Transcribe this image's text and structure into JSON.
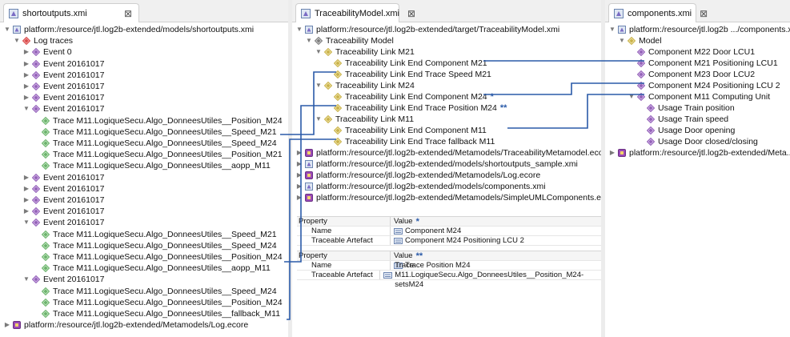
{
  "colors": {
    "link_line": "#2a5aa8",
    "gap": "#ececec",
    "tab_bar": "#f0f0f0"
  },
  "left": {
    "tab_label": "shortoutputs.xmi",
    "close_glyph": "⊠",
    "tree": [
      {
        "label": "platform:/resource/jtl.log2b-extended/models/shortoutputs.xmi",
        "arrow": "▼",
        "icon": "resource-icon",
        "level": 0
      },
      {
        "label": "Log traces",
        "arrow": "▼",
        "icon": "red-diamond-icon",
        "level": 1
      },
      {
        "label": "Event 0",
        "arrow": "▶",
        "icon": "purple-diamond-icon",
        "level": 2
      },
      {
        "label": "Event 20161017",
        "arrow": "▶",
        "icon": "purple-diamond-icon",
        "level": 2
      },
      {
        "label": "Event 20161017",
        "arrow": "▶",
        "icon": "purple-diamond-icon",
        "level": 2
      },
      {
        "label": "Event 20161017",
        "arrow": "▶",
        "icon": "purple-diamond-icon",
        "level": 2
      },
      {
        "label": "Event 20161017",
        "arrow": "▶",
        "icon": "purple-diamond-icon",
        "level": 2
      },
      {
        "label": "Event 20161017",
        "arrow": "▼",
        "icon": "purple-diamond-icon",
        "level": 2
      },
      {
        "label": "Trace M11.LogiqueSecu.Algo_DonneesUtiles__Position_M24",
        "arrow": "",
        "icon": "green-diamond-icon",
        "level": 3
      },
      {
        "label": "Trace M11.LogiqueSecu.Algo_DonneesUtiles__Speed_M21",
        "arrow": "",
        "icon": "green-diamond-icon",
        "level": 3
      },
      {
        "label": "Trace M11.LogiqueSecu.Algo_DonneesUtiles__Speed_M24",
        "arrow": "",
        "icon": "green-diamond-icon",
        "level": 3
      },
      {
        "label": "Trace M11.LogiqueSecu.Algo_DonneesUtiles__Position_M21",
        "arrow": "",
        "icon": "green-diamond-icon",
        "level": 3
      },
      {
        "label": "Trace M11.LogiqueSecu.Algo_DonneesUtiles__aopp_M11",
        "arrow": "",
        "icon": "green-diamond-icon",
        "level": 3
      },
      {
        "label": "Event 20161017",
        "arrow": "▶",
        "icon": "purple-diamond-icon",
        "level": 2
      },
      {
        "label": "Event 20161017",
        "arrow": "▶",
        "icon": "purple-diamond-icon",
        "level": 2
      },
      {
        "label": "Event 20161017",
        "arrow": "▶",
        "icon": "purple-diamond-icon",
        "level": 2
      },
      {
        "label": "Event 20161017",
        "arrow": "▶",
        "icon": "purple-diamond-icon",
        "level": 2
      },
      {
        "label": "Event 20161017",
        "arrow": "▼",
        "icon": "purple-diamond-icon",
        "level": 2
      },
      {
        "label": "Trace M11.LogiqueSecu.Algo_DonneesUtiles__Speed_M21",
        "arrow": "",
        "icon": "green-diamond-icon",
        "level": 3
      },
      {
        "label": "Trace M11.LogiqueSecu.Algo_DonneesUtiles__Speed_M24",
        "arrow": "",
        "icon": "green-diamond-icon",
        "level": 3
      },
      {
        "label": "Trace M11.LogiqueSecu.Algo_DonneesUtiles__Position_M24",
        "arrow": "",
        "icon": "green-diamond-icon",
        "level": 3
      },
      {
        "label": "Trace M11.LogiqueSecu.Algo_DonneesUtiles__aopp_M11",
        "arrow": "",
        "icon": "green-diamond-icon",
        "level": 3
      },
      {
        "label": "Event 20161017",
        "arrow": "▼",
        "icon": "purple-diamond-icon",
        "level": 2
      },
      {
        "label": "Trace M11.LogiqueSecu.Algo_DonneesUtiles__Speed_M24",
        "arrow": "",
        "icon": "green-diamond-icon",
        "level": 3
      },
      {
        "label": "Trace M11.LogiqueSecu.Algo_DonneesUtiles__Position_M24",
        "arrow": "",
        "icon": "green-diamond-icon",
        "level": 3
      },
      {
        "label": "Trace M11.LogiqueSecu.Algo_DonneesUtiles__fallback_M11",
        "arrow": "",
        "icon": "green-diamond-icon",
        "level": 3
      },
      {
        "label": "platform:/resource/jtl.log2b-extended/Metamodels/Log.ecore",
        "arrow": "▶",
        "icon": "ecore-icon",
        "level": 0
      }
    ]
  },
  "middle": {
    "tab_label": "TraceabilityModel.xmi",
    "close_glyph": "⊠",
    "tree": [
      {
        "label": "platform:/resource/jtl.log2b-extended/target/TraceabilityModel.xmi",
        "arrow": "▼",
        "icon": "resource-icon",
        "level": 0
      },
      {
        "label": "Traceability Model",
        "arrow": "▼",
        "icon": "gray-diamond-icon",
        "level": 1
      },
      {
        "label": "Traceability Link M21",
        "arrow": "▼",
        "icon": "yellow-diamond-icon",
        "level": 2
      },
      {
        "label": "Traceability Link End Component M21",
        "arrow": "",
        "icon": "yellow-diamond-icon",
        "level": 3
      },
      {
        "label": "Traceability Link End Trace Speed M21",
        "arrow": "",
        "icon": "yellow-diamond-icon",
        "level": 3
      },
      {
        "label": "Traceability Link M24",
        "arrow": "▼",
        "icon": "yellow-diamond-icon",
        "level": 2
      },
      {
        "label": "Traceability Link End Component M24",
        "arrow": "",
        "icon": "yellow-diamond-icon",
        "level": 3,
        "marker": "*"
      },
      {
        "label": "Traceability Link End Trace Position M24",
        "arrow": "",
        "icon": "yellow-diamond-icon",
        "level": 3,
        "marker": "**"
      },
      {
        "label": "Traceability Link M11",
        "arrow": "▼",
        "icon": "yellow-diamond-icon",
        "level": 2
      },
      {
        "label": "Traceability Link End Component M11",
        "arrow": "",
        "icon": "yellow-diamond-icon",
        "level": 3
      },
      {
        "label": "Traceability Link End Trace fallback M11",
        "arrow": "",
        "icon": "yellow-diamond-icon",
        "level": 3
      },
      {
        "label": "platform:/resource/jtl.log2b-extended/Metamodels/TraceabilityMetamodel.ecore",
        "arrow": "▶",
        "icon": "ecore-icon",
        "level": 0
      },
      {
        "label": "platform:/resource/jtl.log2b-extended/models/shortoutputs_sample.xmi",
        "arrow": "▶",
        "icon": "resource-icon",
        "level": 0
      },
      {
        "label": "platform:/resource/jtl.log2b-extended/Metamodels/Log.ecore",
        "arrow": "▶",
        "icon": "ecore-icon",
        "level": 0
      },
      {
        "label": "platform:/resource/jtl.log2b-extended/models/components.xmi",
        "arrow": "▶",
        "icon": "resource-icon",
        "level": 0
      },
      {
        "label": "platform:/resource/jtl.log2b-extended/Metamodels/SimpleUMLComponents.ecore",
        "arrow": "▶",
        "icon": "ecore-icon",
        "level": 0
      }
    ],
    "properties": [
      {
        "header_property": "Property",
        "header_value": "Value",
        "marker": "*",
        "rows": [
          {
            "name": "Name",
            "value": "Component M24"
          },
          {
            "name": "Traceable Artefact",
            "value": "Component M24 Positioning LCU 2"
          }
        ]
      },
      {
        "header_property": "Property",
        "header_value": "Value",
        "marker": "**",
        "rows": [
          {
            "name": "Name",
            "value": "Trace Position M24"
          },
          {
            "name": "Traceable Artefact",
            "value": "Trace M11.LogiqueSecu.Algo_DonneesUtiles__Position_M24-setsM24"
          }
        ]
      }
    ]
  },
  "right": {
    "tab_label": "components.xmi",
    "close_glyph": "⊠",
    "tree": [
      {
        "label": "platform:/resource/jtl.log2b .../components.xmi",
        "arrow": "▼",
        "icon": "resource-icon",
        "level": 0
      },
      {
        "label": "Model",
        "arrow": "▼",
        "icon": "yellow-diamond-icon",
        "level": 1
      },
      {
        "label": "Component M22 Door LCU1",
        "arrow": "",
        "icon": "purple-diamond-icon",
        "level": 2
      },
      {
        "label": "Component M21 Positioning LCU1",
        "arrow": "",
        "icon": "purple-diamond-icon",
        "level": 2
      },
      {
        "label": "Component M23 Door LCU2",
        "arrow": "",
        "icon": "purple-diamond-icon",
        "level": 2
      },
      {
        "label": "Component M24 Positioning LCU 2",
        "arrow": "",
        "icon": "purple-diamond-icon",
        "level": 2
      },
      {
        "label": "Component M11 Computing Unit",
        "arrow": "▼",
        "icon": "purple-diamond-icon",
        "level": 2
      },
      {
        "label": "Usage Train position",
        "arrow": "",
        "icon": "purple-diamond-icon",
        "level": 3
      },
      {
        "label": "Usage Train speed",
        "arrow": "",
        "icon": "purple-diamond-icon",
        "level": 3
      },
      {
        "label": "Usage Door opening",
        "arrow": "",
        "icon": "purple-diamond-icon",
        "level": 3
      },
      {
        "label": "Usage Door closed/closing",
        "arrow": "",
        "icon": "purple-diamond-icon",
        "level": 3
      },
      {
        "label": "platform:/resource/jtl.log2b-extended/Meta...",
        "arrow": "▶",
        "icon": "ecore-icon",
        "level": 0
      }
    ]
  }
}
